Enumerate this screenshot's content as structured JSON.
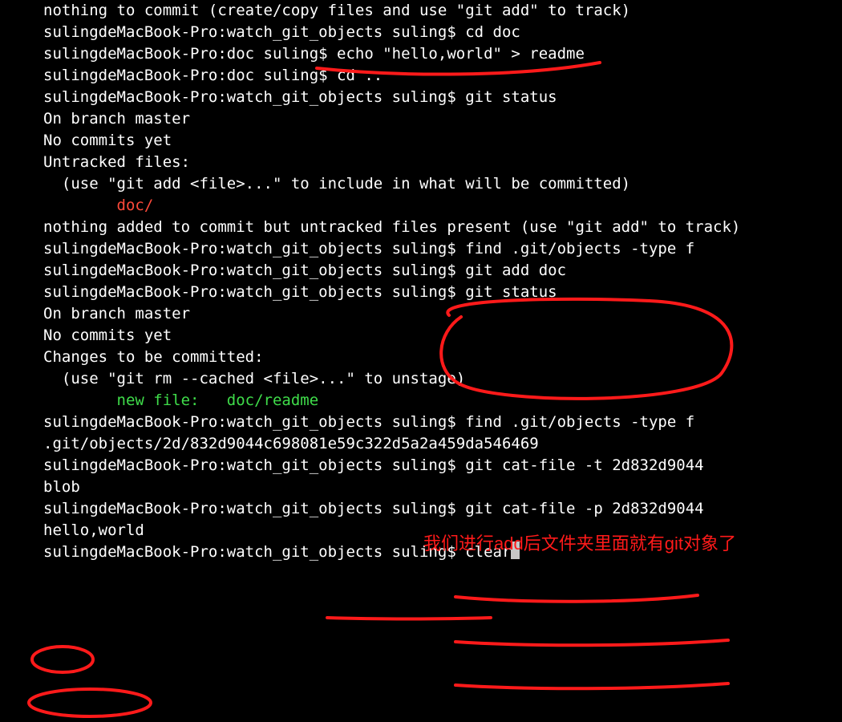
{
  "lines": [
    {
      "segs": [
        {
          "t": "nothing to commit (create/copy files and use \"git add\" to track)"
        }
      ]
    },
    {
      "segs": [
        {
          "t": "sulingdeMacBook-Pro:watch_git_objects suling$ cd doc"
        }
      ]
    },
    {
      "segs": [
        {
          "t": "sulingdeMacBook-Pro:doc suling$ echo \"hello,world\" > readme"
        }
      ]
    },
    {
      "segs": [
        {
          "t": "sulingdeMacBook-Pro:doc suling$ cd .."
        }
      ]
    },
    {
      "segs": [
        {
          "t": "sulingdeMacBook-Pro:watch_git_objects suling$ git status"
        }
      ]
    },
    {
      "segs": [
        {
          "t": "On branch master"
        }
      ]
    },
    {
      "segs": [
        {
          "t": ""
        }
      ]
    },
    {
      "segs": [
        {
          "t": "No commits yet"
        }
      ]
    },
    {
      "segs": [
        {
          "t": ""
        }
      ]
    },
    {
      "segs": [
        {
          "t": "Untracked files:"
        }
      ]
    },
    {
      "segs": [
        {
          "t": "  (use \"git add <file>...\" to include in what will be committed)"
        }
      ]
    },
    {
      "segs": [
        {
          "t": ""
        }
      ]
    },
    {
      "segs": [
        {
          "t": "        "
        },
        {
          "t": "doc/",
          "cls": "red"
        }
      ]
    },
    {
      "segs": [
        {
          "t": ""
        }
      ]
    },
    {
      "segs": [
        {
          "t": "nothing added to commit but untracked files present (use \"git add\" to track)"
        }
      ]
    },
    {
      "segs": [
        {
          "t": "sulingdeMacBook-Pro:watch_git_objects suling$ find .git/objects -type f"
        }
      ]
    },
    {
      "segs": [
        {
          "t": "sulingdeMacBook-Pro:watch_git_objects suling$ git add doc"
        }
      ]
    },
    {
      "segs": [
        {
          "t": "sulingdeMacBook-Pro:watch_git_objects suling$ git status"
        }
      ]
    },
    {
      "segs": [
        {
          "t": "On branch master"
        }
      ]
    },
    {
      "segs": [
        {
          "t": ""
        }
      ]
    },
    {
      "segs": [
        {
          "t": "No commits yet"
        }
      ]
    },
    {
      "segs": [
        {
          "t": ""
        }
      ]
    },
    {
      "segs": [
        {
          "t": "Changes to be committed:"
        }
      ]
    },
    {
      "segs": [
        {
          "t": "  (use \"git rm --cached <file>...\" to unstage)"
        }
      ]
    },
    {
      "segs": [
        {
          "t": ""
        }
      ]
    },
    {
      "segs": [
        {
          "t": "        "
        },
        {
          "t": "new file:   doc/readme",
          "cls": "green"
        }
      ]
    },
    {
      "segs": [
        {
          "t": ""
        }
      ]
    },
    {
      "segs": [
        {
          "t": "sulingdeMacBook-Pro:watch_git_objects suling$ find .git/objects -type f"
        }
      ]
    },
    {
      "segs": [
        {
          "t": ".git/objects/2d/832d9044c698081e59c322d5a2a459da546469"
        }
      ]
    },
    {
      "segs": [
        {
          "t": "sulingdeMacBook-Pro:watch_git_objects suling$ git cat-file -t 2d832d9044"
        }
      ]
    },
    {
      "segs": [
        {
          "t": "blob"
        }
      ]
    },
    {
      "segs": [
        {
          "t": "sulingdeMacBook-Pro:watch_git_objects suling$ git cat-file -p 2d832d9044"
        }
      ]
    },
    {
      "segs": [
        {
          "t": "hello,world"
        }
      ]
    },
    {
      "segs": [
        {
          "t": "sulingdeMacBook-Pro:watch_git_objects suling$ clear"
        }
      ],
      "cursor": true
    }
  ],
  "annotation_text": "我们进行add后文件夹里面就有git对象了",
  "colors": {
    "bg": "#000000",
    "fg": "#ffffff",
    "git_untracked": "#ff4a3a",
    "git_staged": "#3fdc4a",
    "annotation": "#ff1a1a"
  }
}
